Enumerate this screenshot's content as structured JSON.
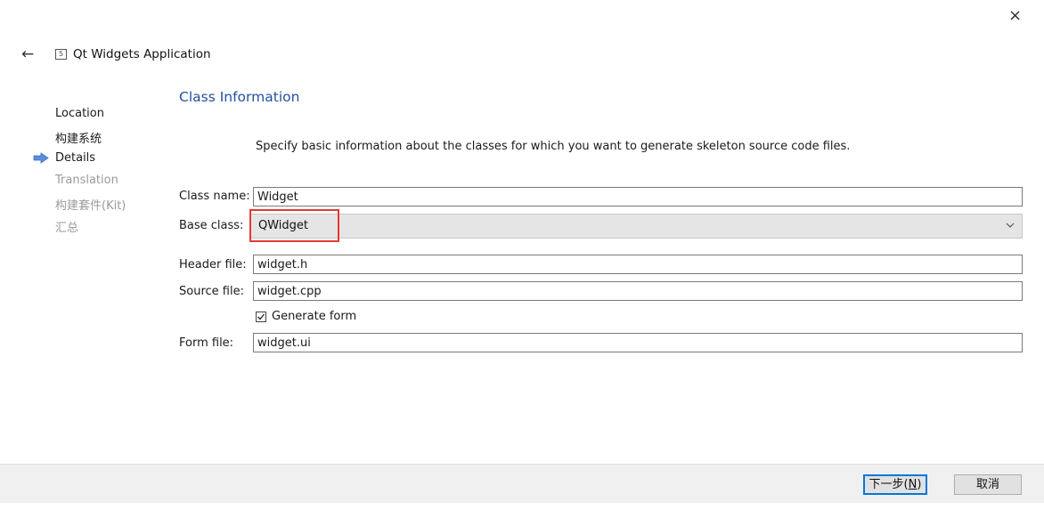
{
  "window": {
    "close_glyph": "×",
    "back_glyph": "←",
    "title": "Qt Widgets Application"
  },
  "steps": [
    {
      "label": "Location",
      "state": "done"
    },
    {
      "label": "构建系统",
      "state": "done"
    },
    {
      "label": "Details",
      "state": "current"
    },
    {
      "label": "Translation",
      "state": "todo"
    },
    {
      "label": "构建套件(Kit)",
      "state": "todo"
    },
    {
      "label": "汇总",
      "state": "todo"
    }
  ],
  "section": {
    "title": "Class Information",
    "description": "Specify basic information about the classes for which you want to generate skeleton source code files."
  },
  "form": {
    "class_name": {
      "label": "Class name:",
      "value": "Widget"
    },
    "base_class": {
      "label": "Base class:",
      "value": "QWidget"
    },
    "header_file": {
      "label": "Header file:",
      "value": "widget.h"
    },
    "source_file": {
      "label": "Source file:",
      "value": "widget.cpp"
    },
    "generate_form": {
      "label": "Generate form",
      "checked": true
    },
    "form_file": {
      "label": "Form file:",
      "value": "widget.ui"
    }
  },
  "buttons": {
    "next_main": "下一步(",
    "next_mnemonic": "N",
    "next_close": ")",
    "cancel": "取消"
  },
  "colors": {
    "accent": "#2450a0",
    "highlight": "#e53935",
    "step_arrow": "#5b8fdc"
  }
}
